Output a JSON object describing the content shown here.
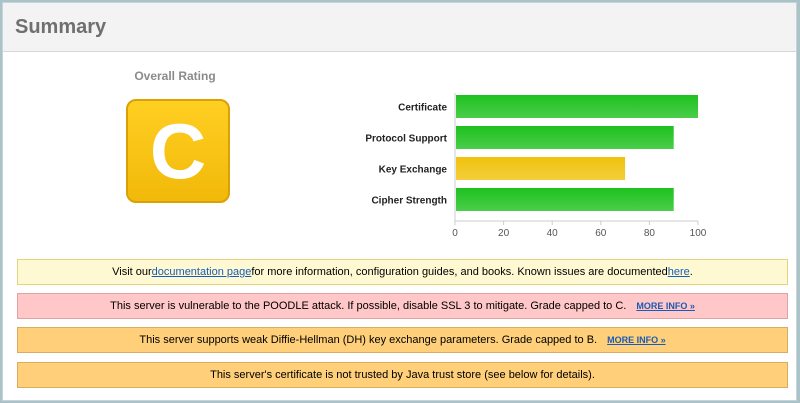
{
  "header": {
    "title": "Summary"
  },
  "rating": {
    "label": "Overall Rating",
    "grade": "C",
    "grade_color": "#ffc81a"
  },
  "chart_data": {
    "type": "bar",
    "orientation": "horizontal",
    "categories": [
      "Certificate",
      "Protocol Support",
      "Key Exchange",
      "Cipher Strength"
    ],
    "values": [
      100,
      90,
      70,
      90
    ],
    "colors": [
      "#1ec11e",
      "#1ec11e",
      "#f0c20c",
      "#1ec11e"
    ],
    "xlim": [
      0,
      100
    ],
    "x_ticks": [
      0,
      20,
      40,
      60,
      80,
      100
    ],
    "x_tick_labels": [
      "0",
      "20",
      "40",
      "60",
      "80",
      "100"
    ]
  },
  "notices": {
    "docs": {
      "prefix": "Visit our ",
      "link": "documentation page",
      "middle": " for more information, configuration guides, and books. Known issues are documented ",
      "link2": "here",
      "suffix": "."
    },
    "poodle": {
      "text": "This server is vulnerable to the POODLE attack. If possible, disable SSL 3 to mitigate. Grade capped to C.",
      "more": "MORE INFO »"
    },
    "dh": {
      "text": "This server supports weak Diffie-Hellman (DH) key exchange parameters. Grade capped to B.",
      "more": "MORE INFO »"
    },
    "java": {
      "text": "This server's certificate is not trusted by Java trust store (see below for details)."
    }
  }
}
